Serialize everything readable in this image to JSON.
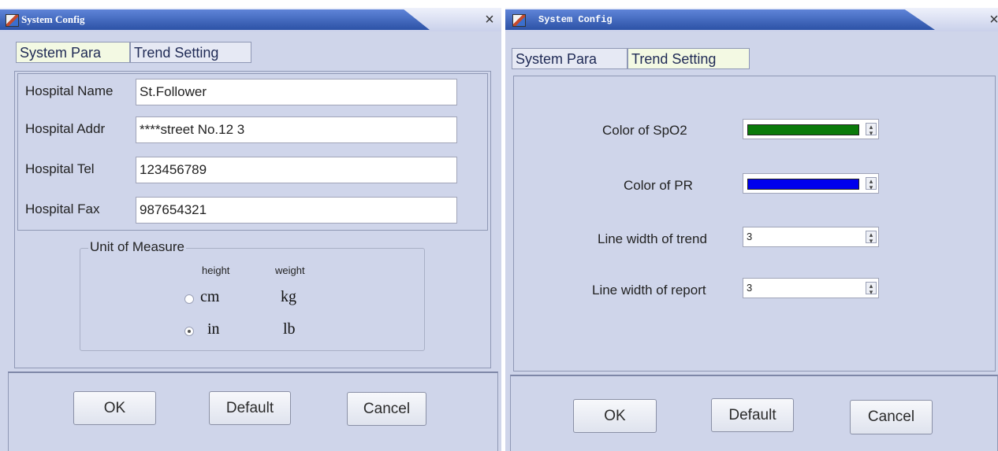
{
  "window": {
    "title": "System Config",
    "close_symbol": "×"
  },
  "tabs": [
    "System Para",
    "Trend Setting"
  ],
  "system_para": {
    "fields": [
      {
        "label": "Hospital Name",
        "value": "St.Follower"
      },
      {
        "label": "Hospital Addr",
        "value": "****street  No.12 3"
      },
      {
        "label": "Hospital Tel",
        "value": "123456789"
      },
      {
        "label": "Hospital Fax",
        "value": "987654321"
      }
    ],
    "unit_group": {
      "title": "Unit of Measure",
      "col_height": "height",
      "col_weight": "weight",
      "options": [
        {
          "height": "cm",
          "weight": "kg",
          "selected": false
        },
        {
          "height": "in",
          "weight": "lb",
          "selected": true
        }
      ]
    }
  },
  "trend_setting": {
    "spo2_label": "Color of SpO2",
    "spo2_color": "#0a7a0a",
    "pr_label": "Color of PR",
    "pr_color": "#0000ee",
    "trend_width_label": "Line width of trend",
    "trend_width_value": "3",
    "report_width_label": "Line width of report",
    "report_width_value": "3"
  },
  "buttons": {
    "ok": "OK",
    "default": "Default",
    "cancel": "Cancel"
  },
  "icons": {
    "window": "app-icon",
    "close": "close-icon",
    "dropdown": "dropdown-icon",
    "spinner": "spinner-icon"
  }
}
